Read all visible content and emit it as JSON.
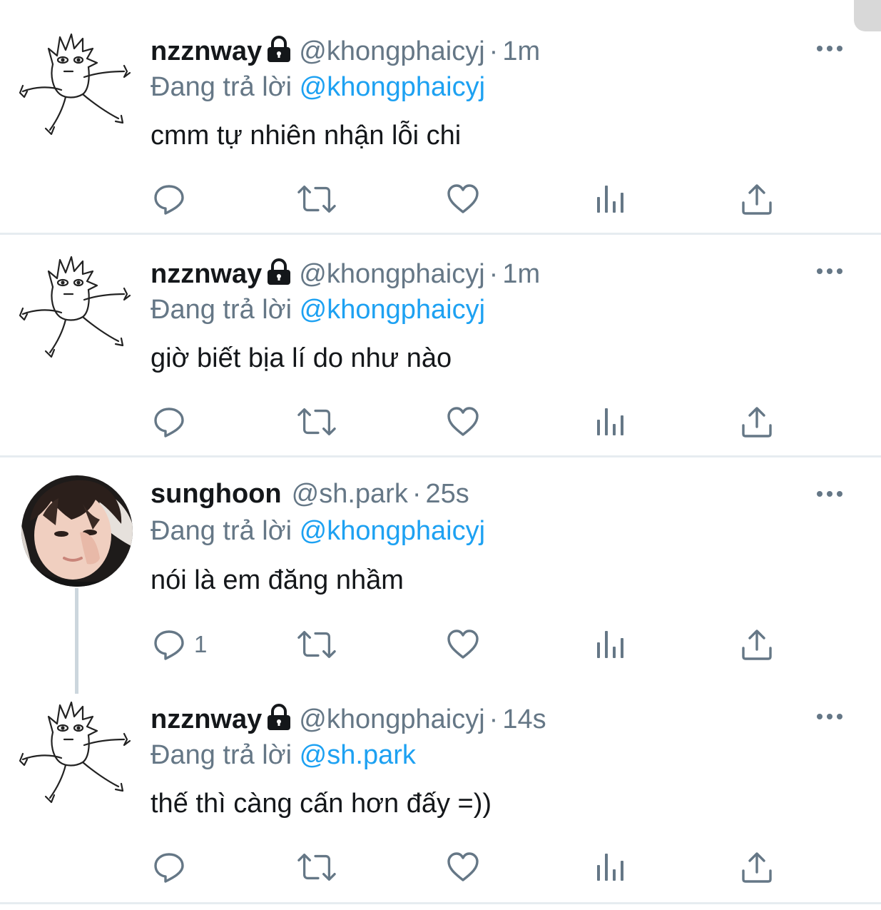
{
  "colors": {
    "accent": "#1da1f2",
    "secondary": "#657786",
    "text": "#14171a",
    "divider": "#e6ecf0"
  },
  "tweets": [
    {
      "name": "nzznway",
      "locked": true,
      "handle": "@khongphaicyj",
      "separator": "·",
      "time": "1m",
      "replying_prefix": "Đang trả lời",
      "replying_to": "@khongphaicyj",
      "text": "cmm tự nhiên nhận lỗi chi",
      "reply_count": ""
    },
    {
      "name": "nzznway",
      "locked": true,
      "handle": "@khongphaicyj",
      "separator": "·",
      "time": "1m",
      "replying_prefix": "Đang trả lời",
      "replying_to": "@khongphaicyj",
      "text": "giờ biết bịa lí do như nào",
      "reply_count": ""
    },
    {
      "name": "sunghoon",
      "locked": false,
      "handle": "@sh.park",
      "separator": "·",
      "time": "25s",
      "replying_prefix": "Đang trả lời",
      "replying_to": "@khongphaicyj",
      "text": "nói là em đăng nhầm",
      "reply_count": "1"
    },
    {
      "name": "nzznway",
      "locked": true,
      "handle": "@khongphaicyj",
      "separator": "·",
      "time": "14s",
      "replying_prefix": "Đang trả lời",
      "replying_to": "@sh.park",
      "text": "thế thì càng cấn hơn đấy =))",
      "reply_count": ""
    }
  ],
  "icons": [
    "avatar-doodle",
    "avatar-photo",
    "lock-icon",
    "more-icon",
    "reply-icon",
    "retweet-icon",
    "like-icon",
    "analytics-icon",
    "share-icon"
  ]
}
